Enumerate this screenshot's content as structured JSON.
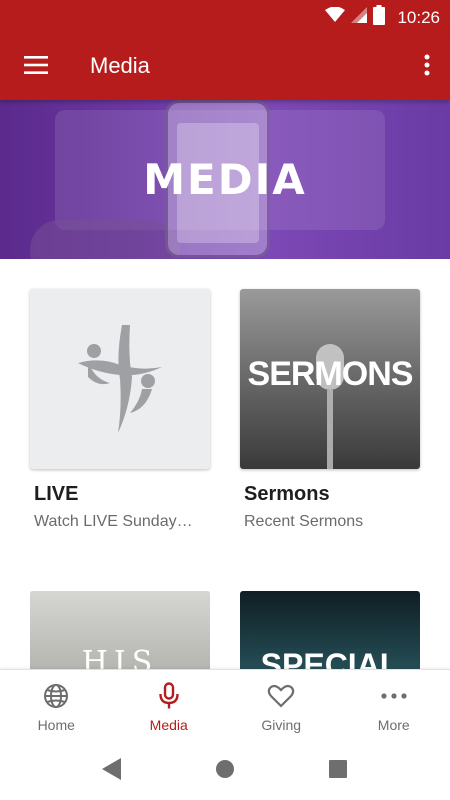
{
  "status_bar": {
    "time": "10:26"
  },
  "app_bar": {
    "title": "Media",
    "menu_icon": "hamburger-menu-icon",
    "overflow_icon": "more-vert-icon"
  },
  "banner": {
    "title": "MEDIA",
    "background_color": "#6d3aa6"
  },
  "media_items": [
    {
      "title": "LIVE",
      "subtitle": "Watch LIVE Sunday…",
      "image_icon": "church-cross-logo-icon"
    },
    {
      "title": "Sermons",
      "subtitle": "Recent Sermons",
      "image_text": "SERMONS"
    },
    {
      "image_text": "HIS STORY"
    },
    {
      "image_text": "SPECIAL"
    }
  ],
  "bottom_nav": {
    "items": [
      {
        "label": "Home",
        "icon": "globe-icon",
        "active": false
      },
      {
        "label": "Media",
        "icon": "microphone-icon",
        "active": true
      },
      {
        "label": "Giving",
        "icon": "heart-icon",
        "active": false
      },
      {
        "label": "More",
        "icon": "more-horiz-icon",
        "active": false
      }
    ]
  },
  "colors": {
    "primary": "#b71c1c",
    "active_nav": "#b71c1c",
    "inactive_nav": "#6e6e6e"
  }
}
